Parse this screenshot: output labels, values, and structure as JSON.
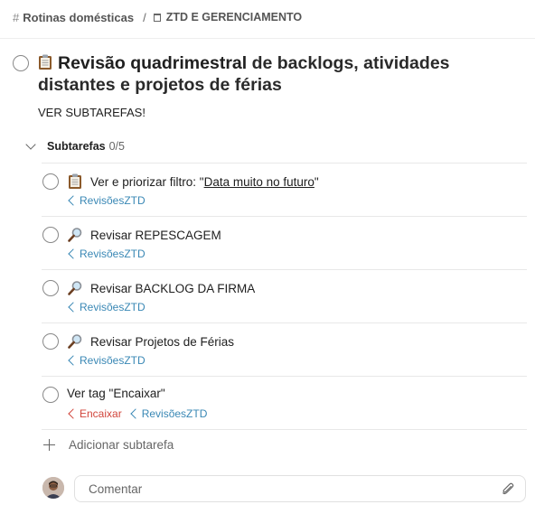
{
  "breadcrumb": {
    "project": "Rotinas domésticas",
    "separator": "/",
    "section": "ZTD E GERENCIAMENTO"
  },
  "task": {
    "title_bold": "Revisão quadrimestral",
    "title_rest": " de backlogs, atividades distantes e projetos de férias",
    "description": "VER SUBTAREFAS!"
  },
  "subtasks": {
    "label": "Subtarefas",
    "count": "0/5",
    "items": [
      {
        "prefix": "Ver e priorizar filtro: \"",
        "link": "Data muito no futuro",
        "suffix": "\"",
        "tags": [
          "RevisõesZTD"
        ],
        "icon": "clipboard-emoji"
      },
      {
        "text": "Revisar REPESCAGEM",
        "tags": [
          "RevisõesZTD"
        ],
        "icon": "magnifier-emoji"
      },
      {
        "text": "Revisar BACKLOG DA FIRMA",
        "tags": [
          "RevisõesZTD"
        ],
        "icon": "magnifier-emoji"
      },
      {
        "text": "Revisar Projetos de Férias",
        "tags": [
          "RevisõesZTD"
        ],
        "icon": "magnifier-emoji"
      },
      {
        "text": "Ver tag \"Encaixar\"",
        "tags": [
          "Encaixar",
          "RevisõesZTD"
        ]
      }
    ],
    "add_label": "Adicionar subtarefa"
  },
  "comment": {
    "placeholder": "Comentar"
  },
  "colors": {
    "tag_blue": "#3a88b5",
    "tag_red": "#d1453b"
  }
}
